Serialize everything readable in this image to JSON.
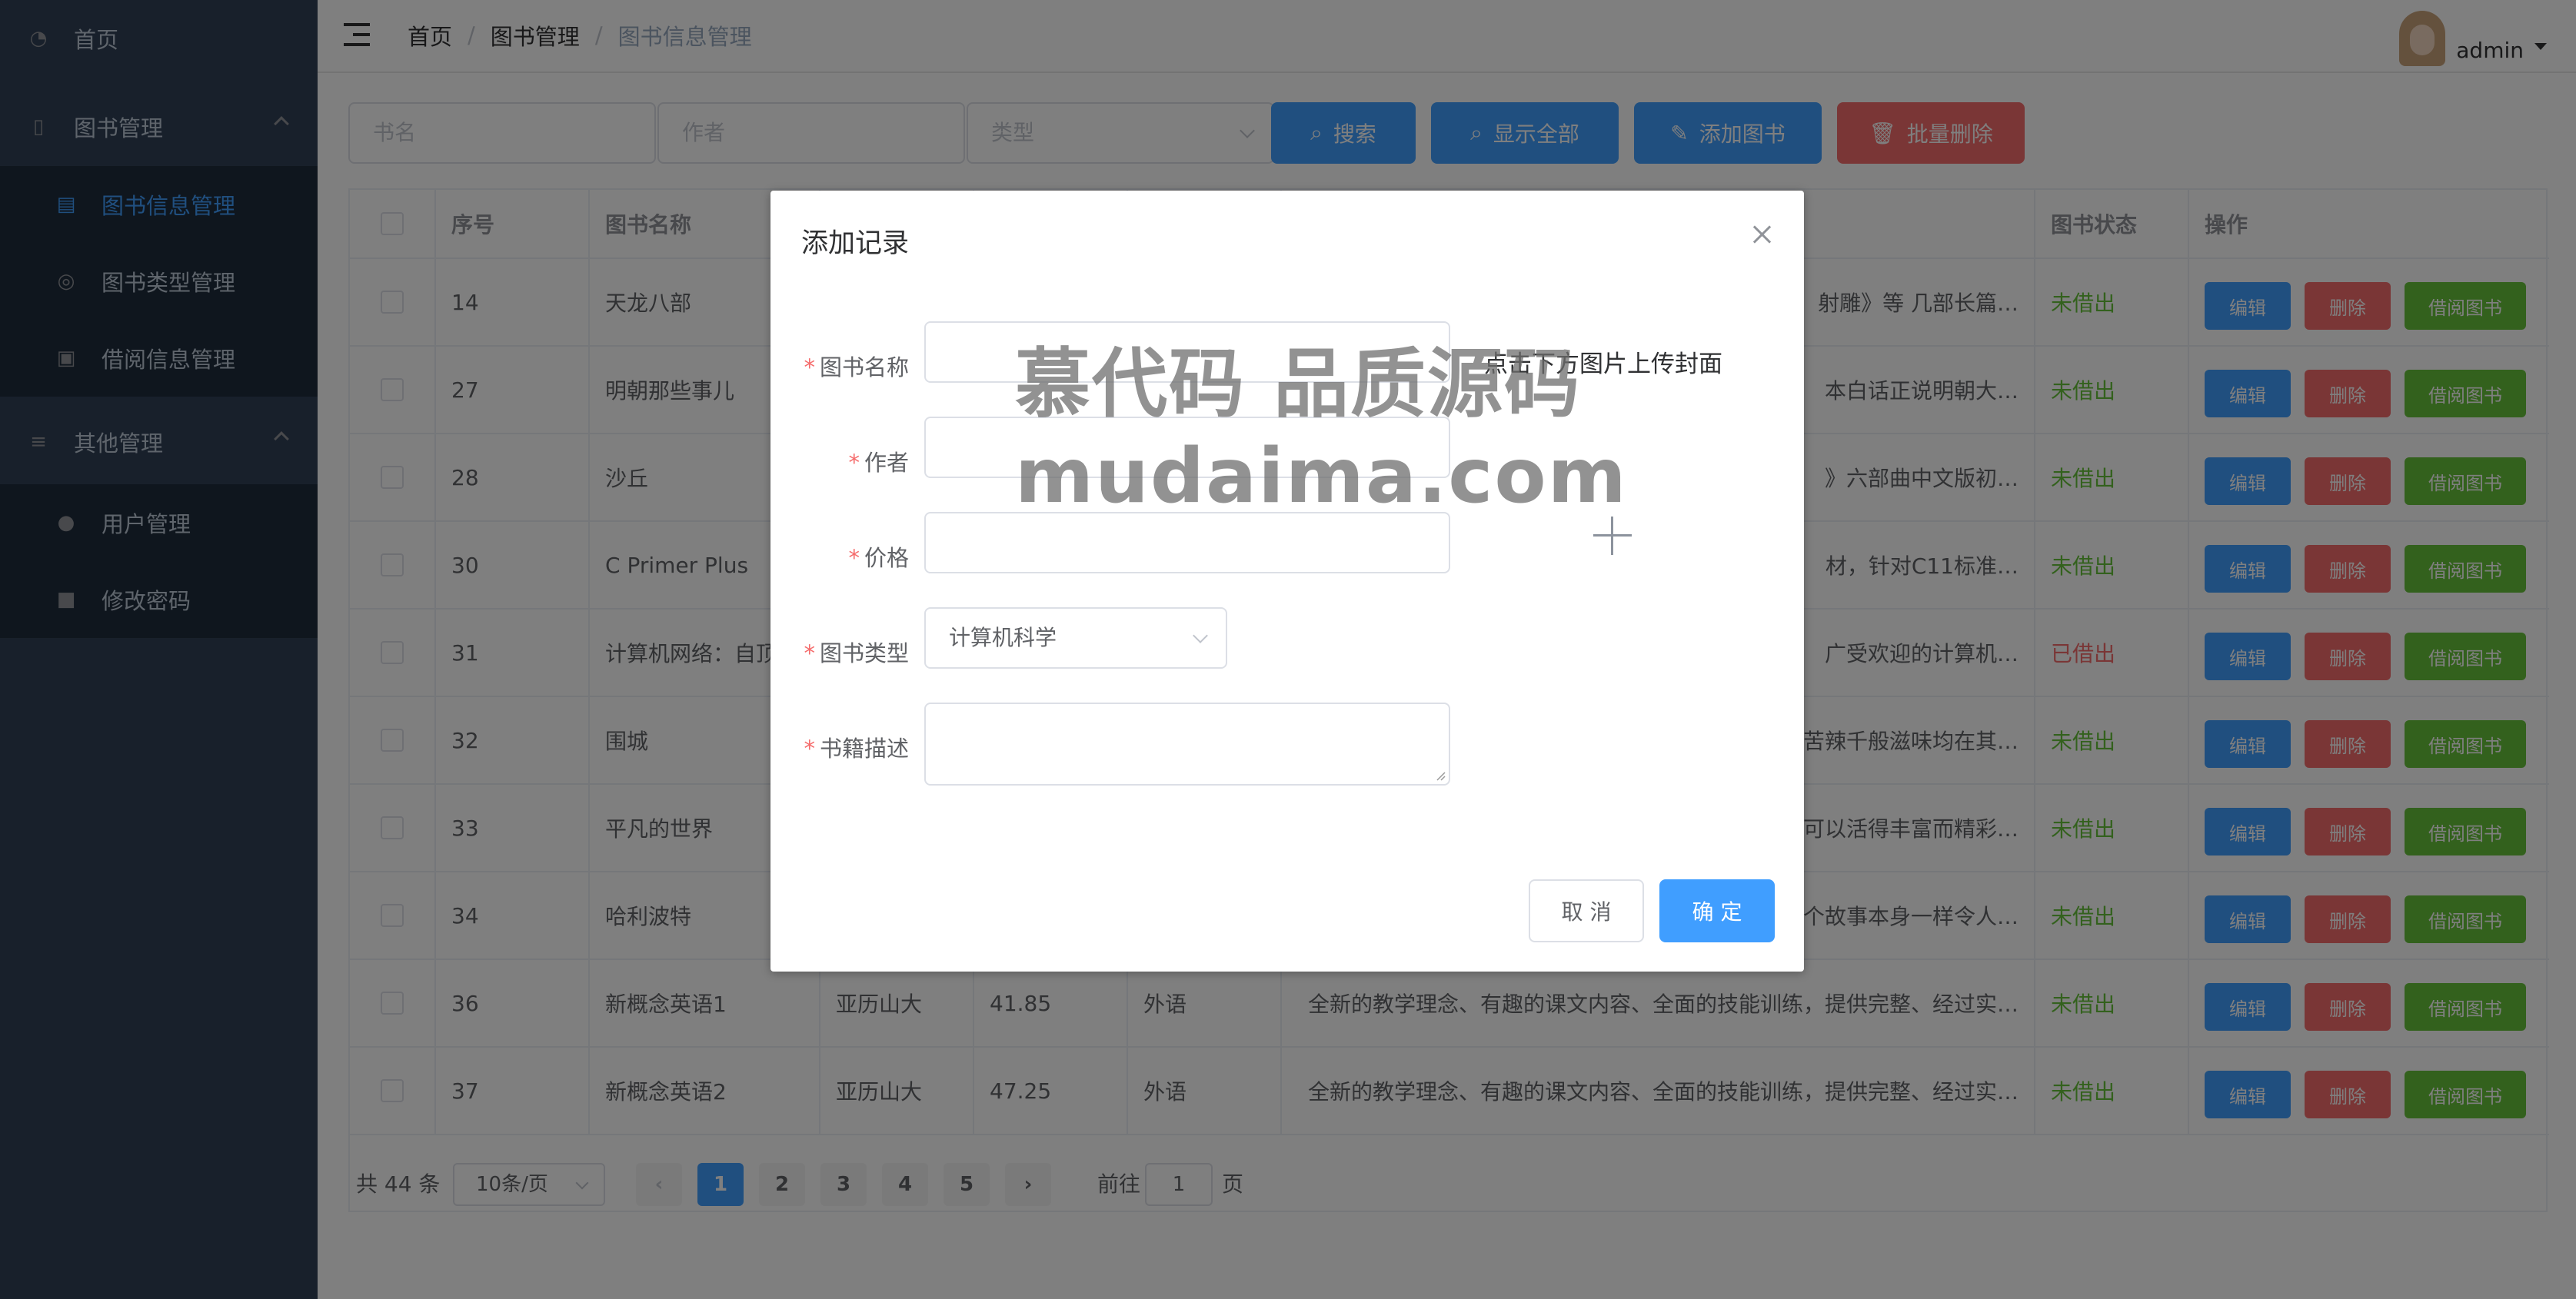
{
  "sidebar": {
    "items": [
      {
        "label": "首页",
        "icon": "dashboard-icon"
      },
      {
        "label": "图书管理",
        "icon": "book-icon"
      },
      {
        "label": "图书信息管理",
        "icon": "document-icon"
      },
      {
        "label": "图书类型管理",
        "icon": "category-icon"
      },
      {
        "label": "借阅信息管理",
        "icon": "borrow-icon"
      },
      {
        "label": "其他管理",
        "icon": "list-icon"
      },
      {
        "label": "用户管理",
        "icon": "user-icon"
      },
      {
        "label": "修改密码",
        "icon": "lock-icon"
      }
    ]
  },
  "header": {
    "breadcrumb": [
      "首页",
      "/",
      "图书管理",
      "/",
      "图书信息管理"
    ],
    "user": "admin"
  },
  "toolbar": {
    "name_placeholder": "书名",
    "author_placeholder": "作者",
    "type_placeholder": "类型",
    "search": "搜索",
    "show_all": "显示全部",
    "add": "添加图书",
    "batch_delete": "批量删除"
  },
  "table": {
    "headers": [
      "序号",
      "图书名称",
      "图书状态",
      "操作"
    ],
    "rows": [
      {
        "id": "14",
        "name": "天龙八部",
        "author": "",
        "price": "",
        "type": "",
        "desc": "射雕》等 几部长篇…",
        "status": "未借出"
      },
      {
        "id": "27",
        "name": "明朝那些事儿",
        "author": "",
        "price": "",
        "type": "",
        "desc": "本白话正说明朝大…",
        "status": "未借出"
      },
      {
        "id": "28",
        "name": "沙丘",
        "author": "",
        "price": "",
        "type": "",
        "desc": "》六部曲中文版初…",
        "status": "未借出"
      },
      {
        "id": "30",
        "name": "C Primer Plus",
        "author": "",
        "price": "",
        "type": "",
        "desc": "材，针对C11标准…",
        "status": "未借出"
      },
      {
        "id": "31",
        "name": "计算机网络：自顶",
        "author": "",
        "price": "",
        "type": "",
        "desc": "广受欢迎的计算机…",
        "status": "已借出"
      },
      {
        "id": "32",
        "name": "围城",
        "author": "",
        "price": "",
        "type": "",
        "desc": "苦辣千般滋味均在其…",
        "status": "未借出"
      },
      {
        "id": "33",
        "name": "平凡的世界",
        "author": "",
        "price": "",
        "type": "",
        "desc": "可以活得丰富而精彩…",
        "status": "未借出"
      },
      {
        "id": "34",
        "name": "哈利波特",
        "author": "",
        "price": "",
        "type": "",
        "desc": "个故事本身一样令人…",
        "status": "未借出"
      },
      {
        "id": "36",
        "name": "新概念英语1",
        "author": "亚历山大",
        "price": "41.85",
        "type": "外语",
        "desc": "全新的教学理念、有趣的课文内容、全面的技能训练，提供完整、经过实…",
        "status": "未借出"
      },
      {
        "id": "37",
        "name": "新概念英语2",
        "author": "亚历山大",
        "price": "47.25",
        "type": "外语",
        "desc": "全新的教学理念、有趣的课文内容、全面的技能训练，提供完整、经过实…",
        "status": "未借出"
      }
    ],
    "ops": {
      "edit": "编辑",
      "delete": "删除",
      "borrow": "借阅图书"
    }
  },
  "pagination": {
    "total": "共 44 条",
    "page_size": "10条/页",
    "pages": [
      "1",
      "2",
      "3",
      "4",
      "5"
    ],
    "current": "1",
    "goto_prefix": "前往",
    "goto_value": "1",
    "goto_suffix": "页"
  },
  "dialog": {
    "title": "添加记录",
    "fields": {
      "name": "图书名称",
      "author": "作者",
      "price": "价格",
      "type": "图书类型",
      "desc": "书籍描述"
    },
    "type_value": "计算机科学",
    "upload_tip": "点击下方图片上传封面",
    "cancel": "取 消",
    "ok": "确 定"
  },
  "watermark": {
    "line1": "慕代码 品质源码",
    "line2": "mudaima.com"
  },
  "colors": {
    "primary": "#409eff",
    "danger": "#f56c6c",
    "success": "#67c23a",
    "sidebar": "#304156"
  }
}
